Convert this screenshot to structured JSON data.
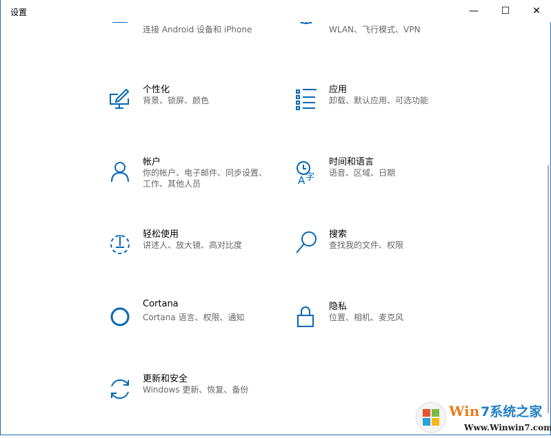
{
  "window": {
    "title": "设置"
  },
  "controls": {
    "minimize": "—",
    "maximize": "☐",
    "close": "✕"
  },
  "items": [
    {
      "title": "",
      "subtitle": "连接 Android 设备和 iPhone",
      "icon": "phone-icon"
    },
    {
      "title": "",
      "subtitle": "WLAN、飞行模式、VPN",
      "icon": "globe-icon"
    },
    {
      "title": "个性化",
      "subtitle": "背景、锁屏、颜色",
      "icon": "personalization-icon"
    },
    {
      "title": "应用",
      "subtitle": "卸载、默认应用、可选功能",
      "icon": "apps-icon"
    },
    {
      "title": "帐户",
      "subtitle": "你的帐户、电子邮件、同步设置、工作、其他人员",
      "icon": "person-icon"
    },
    {
      "title": "时间和语言",
      "subtitle": "语音、区域、日期",
      "icon": "time-language-icon"
    },
    {
      "title": "轻松使用",
      "subtitle": "讲述人、放大镜、高对比度",
      "icon": "ease-of-access-icon"
    },
    {
      "title": "搜索",
      "subtitle": "查找我的文件、权限",
      "icon": "search-icon"
    },
    {
      "title": "Cortana",
      "subtitle": "Cortana 语言、权限、通知",
      "icon": "cortana-icon"
    },
    {
      "title": "隐私",
      "subtitle": "位置、相机、麦克风",
      "icon": "lock-icon"
    },
    {
      "title": "更新和安全",
      "subtitle": "Windows 更新、恢复、备份",
      "icon": "update-icon"
    }
  ],
  "watermark": {
    "brand": "Win7系统之家",
    "url": "Www.Winwin7.com"
  },
  "accent": "#0067b8"
}
